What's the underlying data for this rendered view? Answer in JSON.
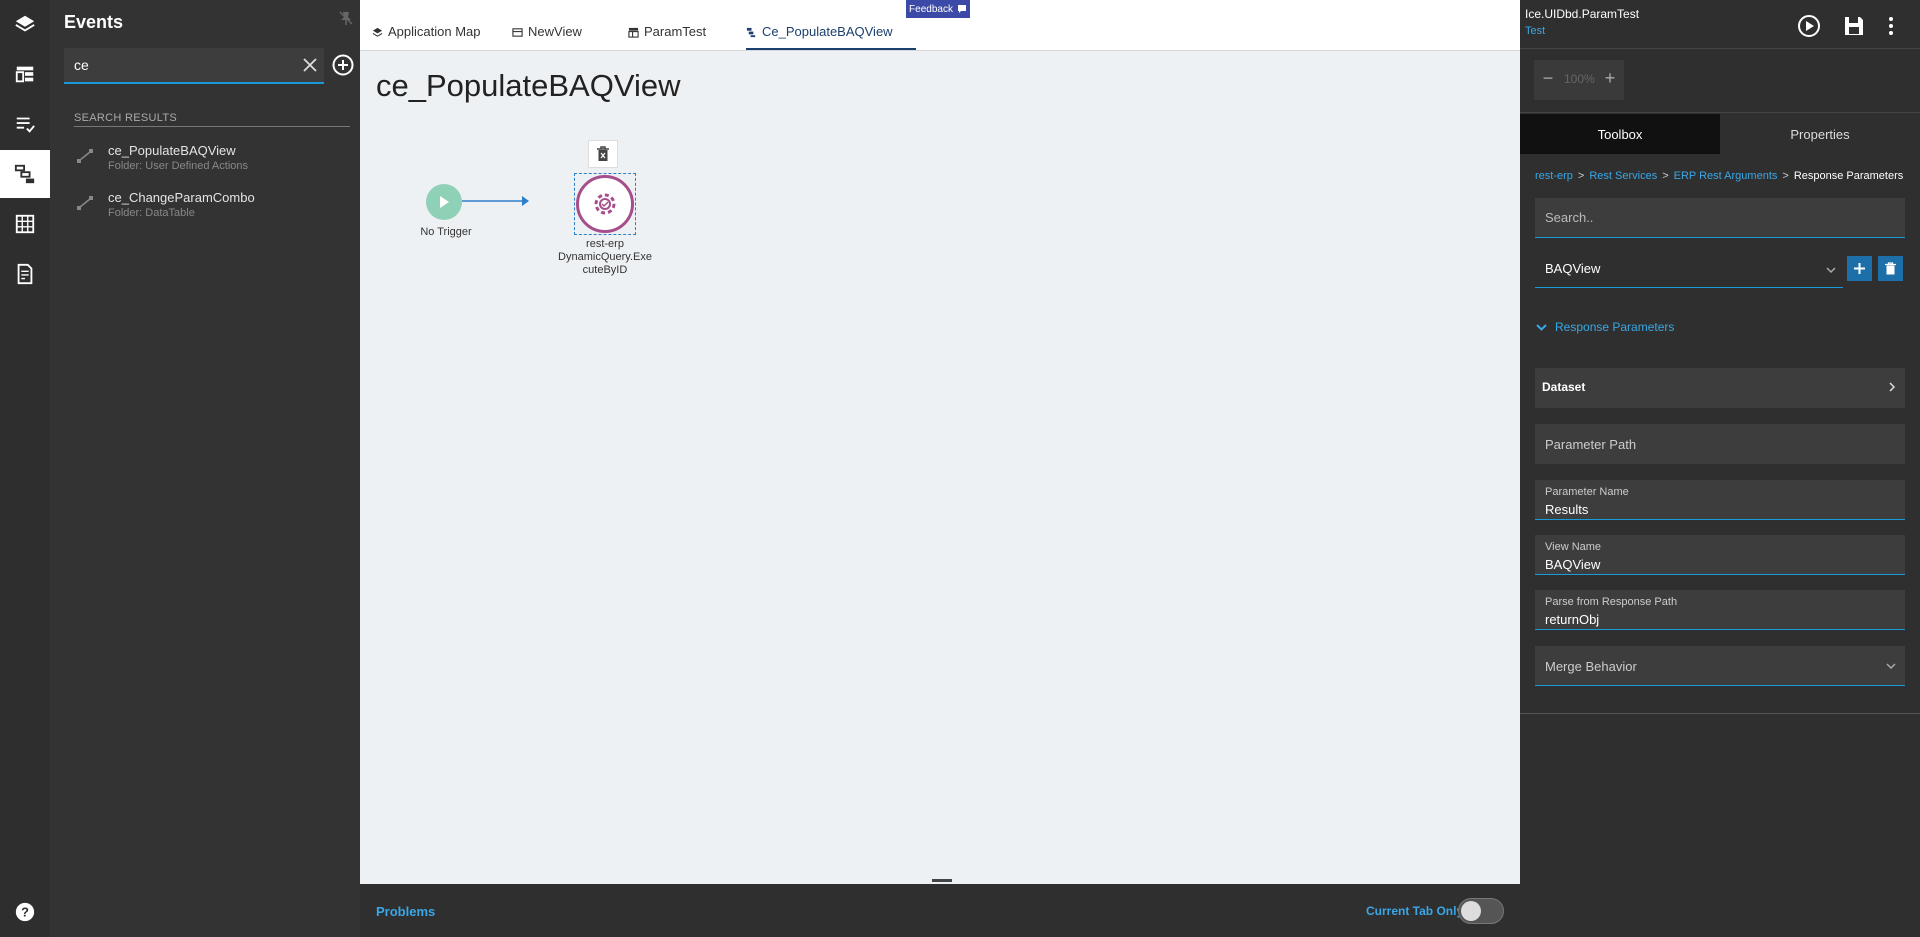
{
  "events_panel": {
    "title": "Events",
    "search_value": "ce",
    "results_label": "SEARCH RESULTS",
    "results": [
      {
        "name": "ce_PopulateBAQView",
        "folder": "Folder: User Defined Actions"
      },
      {
        "name": "ce_ChangeParamCombo",
        "folder": "Folder: DataTable"
      }
    ]
  },
  "tabs": [
    {
      "label": "Application Map",
      "icon": "layers-icon"
    },
    {
      "label": "NewView",
      "icon": "view-icon"
    },
    {
      "label": "ParamTest",
      "icon": "table-icon"
    },
    {
      "label": "Ce_PopulateBAQView",
      "icon": "flow-icon",
      "active": true
    }
  ],
  "feedback_label": "Feedback",
  "canvas": {
    "title": "ce_PopulateBAQView",
    "trigger_label": "No Trigger",
    "widget_label_line1": "rest-erp",
    "widget_label_line2": "DynamicQuery.Exe",
    "widget_label_line3": "cuteByID"
  },
  "problems_bar": {
    "problems_label": "Problems",
    "current_tab_only_label": "Current Tab Only",
    "current_tab_only_on": false
  },
  "right_panel": {
    "app_name": "Ice.UIDbd.ParamTest",
    "app_sub": "Test",
    "zoom_value": "100%",
    "tabs": [
      "Toolbox",
      "Properties"
    ],
    "breadcrumb": [
      "rest-erp",
      "Rest Services",
      "ERP Rest Arguments",
      "Response Parameters"
    ],
    "search_placeholder": "Search..",
    "view_select_value": "BAQView",
    "section_title": "Response Parameters",
    "dataset_label": "Dataset",
    "parameter_path_placeholder": "Parameter Path",
    "parameter_name_label": "Parameter Name",
    "parameter_name_value": "Results",
    "view_name_label": "View Name",
    "view_name_value": "BAQView",
    "parse_label": "Parse from Response Path",
    "parse_value": "returnObj",
    "merge_behavior_placeholder": "Merge Behavior"
  },
  "colors": {
    "accent": "#39a7e6",
    "active_tab": "#1b3f6e",
    "trigger": "#8fd1b6",
    "widget": "#a64d8c",
    "feedback": "#3b4aa6"
  }
}
